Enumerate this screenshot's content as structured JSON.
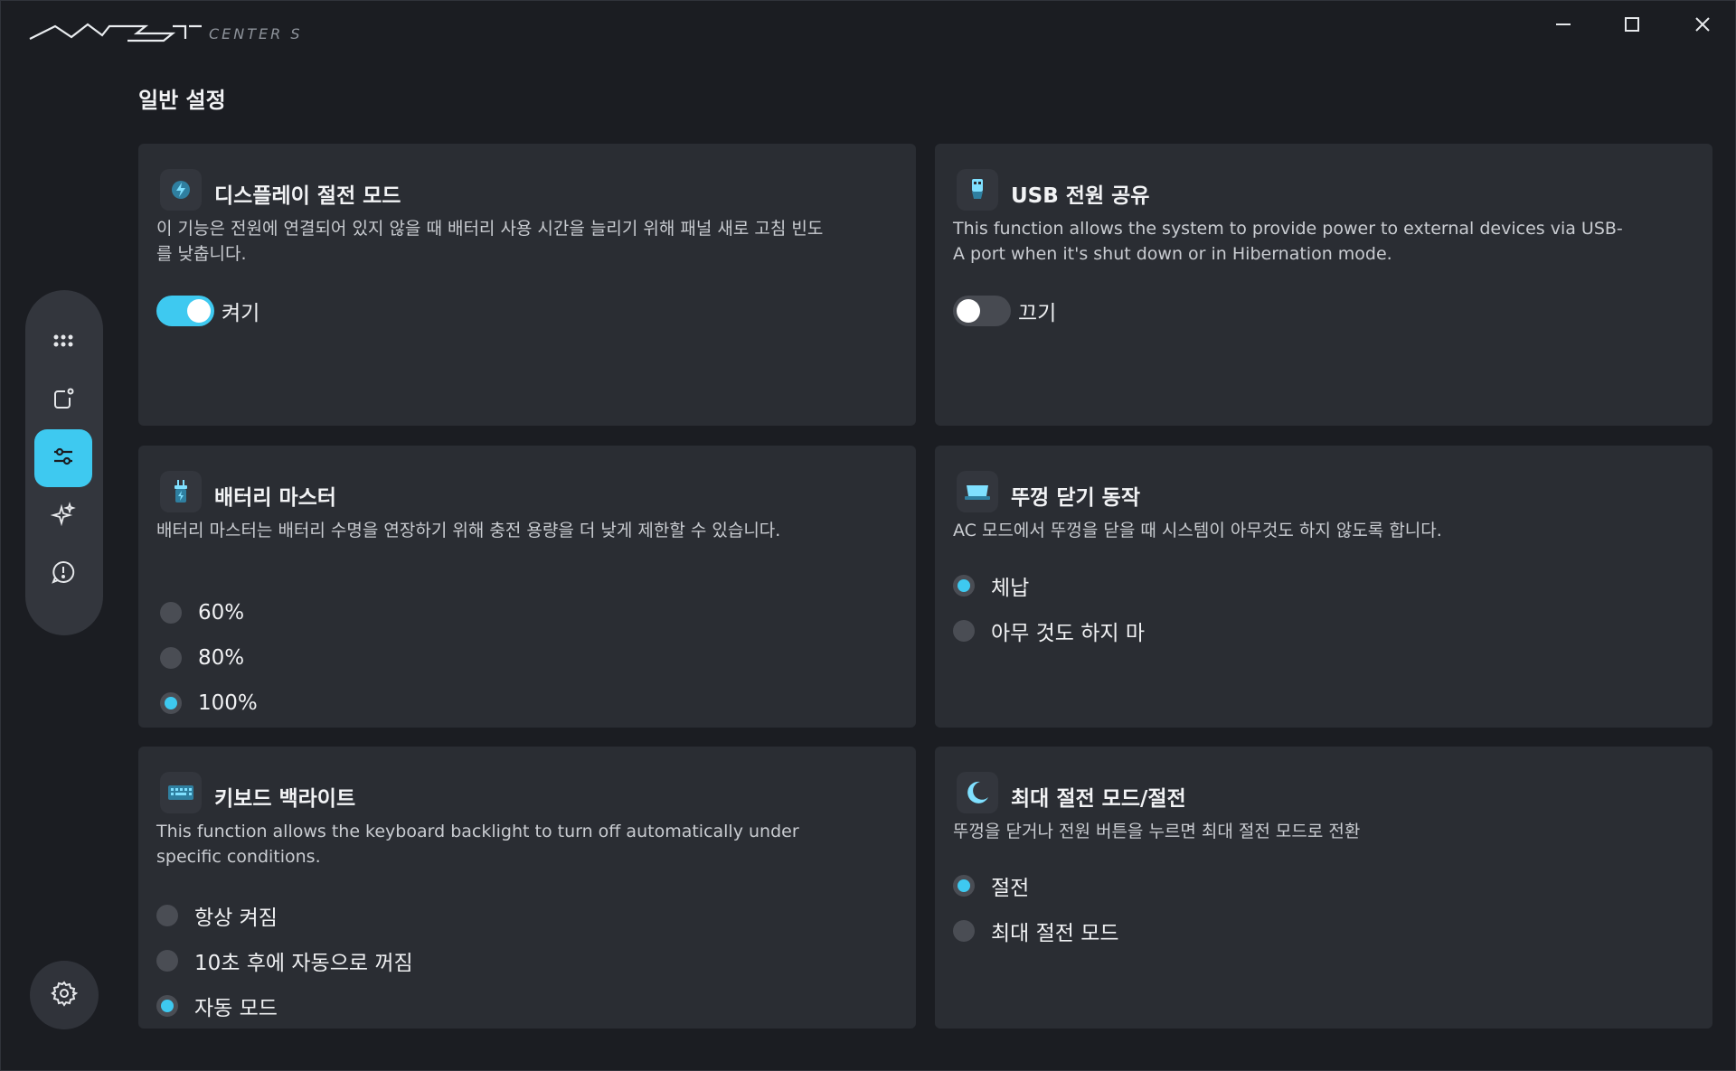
{
  "app": {
    "title": "MSI CENTER S"
  },
  "page": {
    "title": "일반 설정"
  },
  "sidebar": {
    "items": [
      {
        "name": "apps-icon"
      },
      {
        "name": "export-icon"
      },
      {
        "name": "sliders-icon",
        "active": true
      },
      {
        "name": "sparkle-icon"
      },
      {
        "name": "alert-icon"
      }
    ],
    "settings": "gear-icon"
  },
  "cards": {
    "display_saver": {
      "title": "디스플레이 절전 모드",
      "desc": "이 기능은 전원에 연결되어 있지 않을 때 배터리 사용 시간을 늘리기 위해 패널 새로 고침 빈도를 낮춥니다.",
      "toggle_label": "켜기",
      "toggle_on": true
    },
    "usb_power": {
      "title": "USB 전원 공유",
      "desc": "This function allows the system to provide power to external devices via USB-A port when it's shut down or in Hibernation mode.",
      "toggle_label": "끄기",
      "toggle_on": false
    },
    "battery_master": {
      "title": "배터리 마스터",
      "desc": "배터리 마스터는 배터리 수명을 연장하기 위해 충전 용량을 더 낮게 제한할 수 있습니다.",
      "options": [
        "60%",
        "80%",
        "100%"
      ],
      "selected": 2
    },
    "lid_close": {
      "title": "뚜껑 닫기 동작",
      "desc": "AC 모드에서 뚜껑을 닫을 때 시스템이 아무것도 하지 않도록 합니다.",
      "options": [
        "체납",
        "아무 것도 하지 마"
      ],
      "selected": 0
    },
    "keyboard_backlight": {
      "title": "키보드 백라이트",
      "desc": "This function allows the keyboard backlight to turn off automatically under specific conditions.",
      "options": [
        "항상 켜짐",
        "10초 후에 자동으로 꺼짐",
        "자동 모드"
      ],
      "selected": 2
    },
    "max_saving": {
      "title": "최대 절전 모드/절전",
      "desc": "뚜껑을 닫거나 전원 버튼을 누르면 최대 절전 모드로 전환",
      "options": [
        "절전",
        "최대 절전 모드"
      ],
      "selected": 0
    }
  },
  "colors": {
    "accent": "#3ec9f0",
    "card_bg": "#2a2d33",
    "window_bg": "#1b1d22"
  }
}
